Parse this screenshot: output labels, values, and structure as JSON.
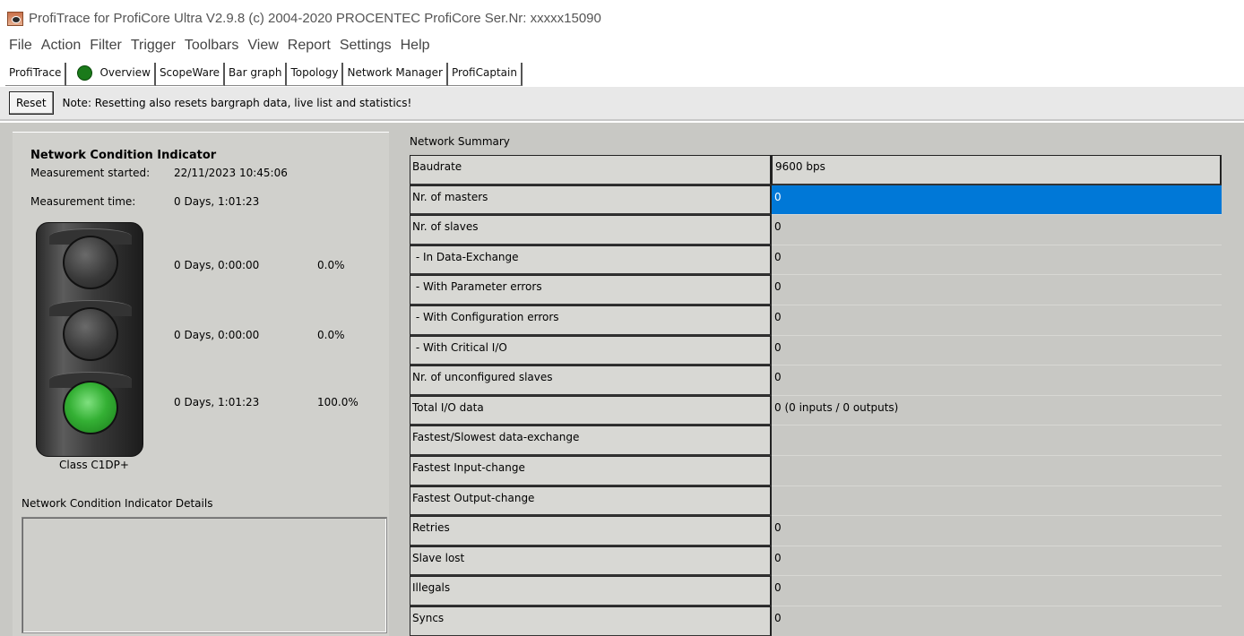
{
  "window": {
    "title": "ProfiTrace for ProfiCore Ultra V2.9.8 (c) 2004-2020 PROCENTEC  ProfiCore Ser.Nr: xxxxx15090",
    "icon": "profitrace-app-icon"
  },
  "menu": [
    "File",
    "Action",
    "Filter",
    "Trigger",
    "Toolbars",
    "View",
    "Report",
    "Settings",
    "Help"
  ],
  "tabs": [
    "ProfiTrace",
    "Overview",
    "ScopeWare",
    "Bar graph",
    "Topology",
    "Network Manager",
    "ProfiCaptain"
  ],
  "active_tab": "Overview",
  "toolbar": {
    "reset_label": "Reset",
    "note": "Note: Resetting also resets bargraph data, live list and statistics!"
  },
  "nci": {
    "title": "Network Condition Indicator",
    "started_label": "Measurement started:",
    "started_value": "22/11/2023 10:45:06",
    "time_label": "Measurement time:",
    "time_value": "0 Days, 1:01:23",
    "lights": [
      {
        "state": "off",
        "duration": "0 Days, 0:00:00",
        "percent": "0.0%"
      },
      {
        "state": "off",
        "duration": "0 Days, 0:00:00",
        "percent": "0.0%"
      },
      {
        "state": "green",
        "duration": "0 Days, 1:01:23",
        "percent": "100.0%"
      }
    ],
    "class_label": "Class C1DP+",
    "details_label": "Network Condition Indicator Details"
  },
  "summary": {
    "title": "Network Summary",
    "rows": [
      {
        "label": "Baudrate",
        "value": "9600 bps"
      },
      {
        "label": "Nr. of masters",
        "value": "0"
      },
      {
        "label": "Nr. of slaves",
        "value": "0"
      },
      {
        "label": " - In Data-Exchange",
        "value": "0"
      },
      {
        "label": " - With Parameter errors",
        "value": "0"
      },
      {
        "label": " - With Configuration errors",
        "value": "0"
      },
      {
        "label": " - With Critical I/O",
        "value": "0"
      },
      {
        "label": "Nr. of unconfigured slaves",
        "value": "0"
      },
      {
        "label": "Total I/O data",
        "value": "0 (0 inputs / 0 outputs)"
      },
      {
        "label": "Fastest/Slowest data-exchange",
        "value": ""
      },
      {
        "label": "Fastest Input-change",
        "value": ""
      },
      {
        "label": "Fastest Output-change",
        "value": ""
      },
      {
        "label": "Retries",
        "value": "0"
      },
      {
        "label": "Slave lost",
        "value": "0"
      },
      {
        "label": "Illegals",
        "value": "0"
      },
      {
        "label": "Syncs",
        "value": "0"
      }
    ],
    "selected_row": "Nr. of masters"
  },
  "colors": {
    "workspace": "#c8c8c4",
    "selection": "#0078d7",
    "green_light": "#34b034",
    "status_dot": "#1a7a1a"
  }
}
